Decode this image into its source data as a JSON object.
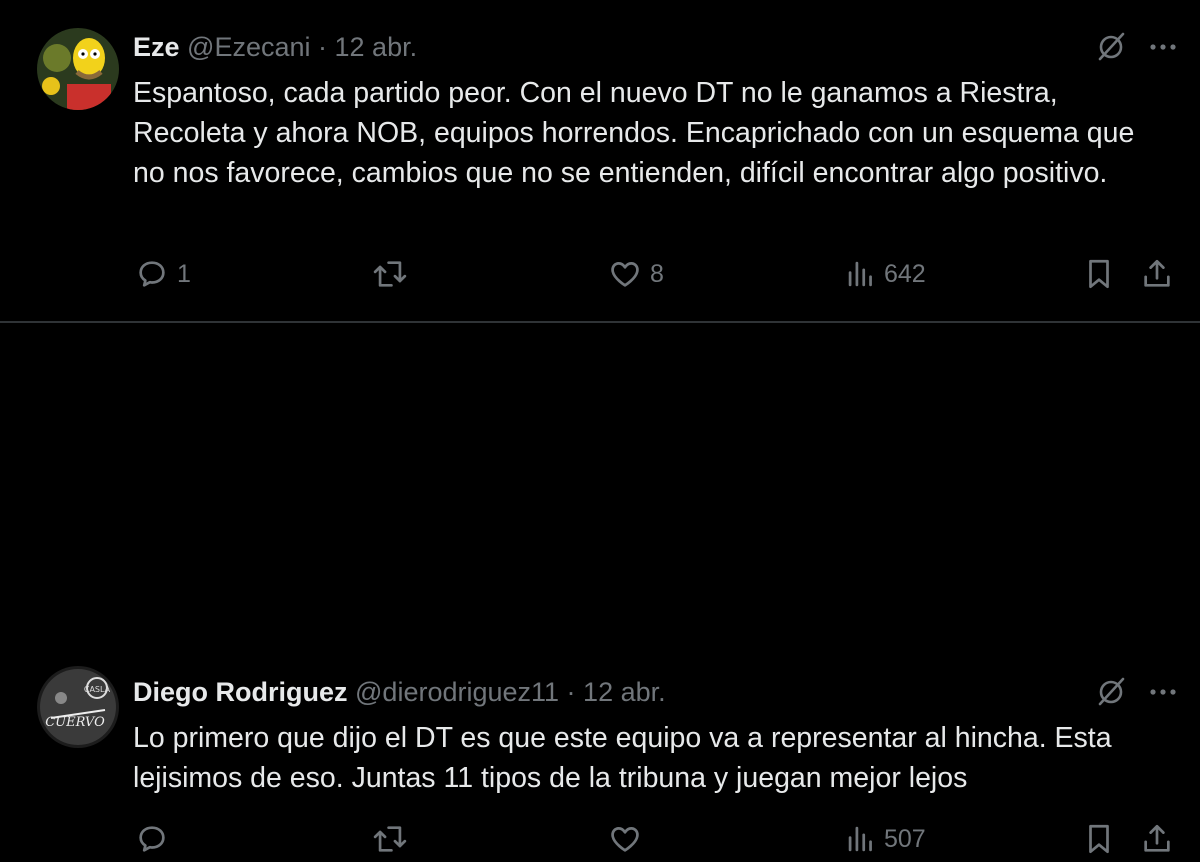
{
  "tweets": [
    {
      "name": "Eze",
      "handle": "@Ezecani",
      "sep": " · ",
      "date": "12 abr.",
      "text": "Espantoso, cada partido peor. Con el nuevo DT no le ganamos a Riestra, Recoleta y ahora NOB, equipos horrendos. Encaprichado con un esquema que no nos favorece, cambios que no se entienden, difícil encontrar algo positivo.",
      "replies": "1",
      "retweets": "",
      "likes": "8",
      "views": "642"
    },
    {
      "name": "Diego Rodriguez",
      "handle": "@dierodriguez11",
      "sep": " · ",
      "date": "12 abr.",
      "text": "Lo primero que dijo el DT es que este equipo va a representar al hincha. Esta lejisimos de eso. Juntas 11 tipos de la tribuna y juegan mejor lejos",
      "replies": "",
      "retweets": "",
      "likes": "",
      "views": "507"
    }
  ],
  "icons": {
    "reply": "reply-icon",
    "retweet": "retweet-icon",
    "like": "heart-icon",
    "views": "analytics-icon",
    "bookmark": "bookmark-icon",
    "share": "share-icon",
    "grok": "grok-icon",
    "more": "more-icon"
  },
  "colors": {
    "background": "#000000",
    "text": "#e7e9ea",
    "secondary": "#71767b",
    "divider": "#2f3336"
  }
}
